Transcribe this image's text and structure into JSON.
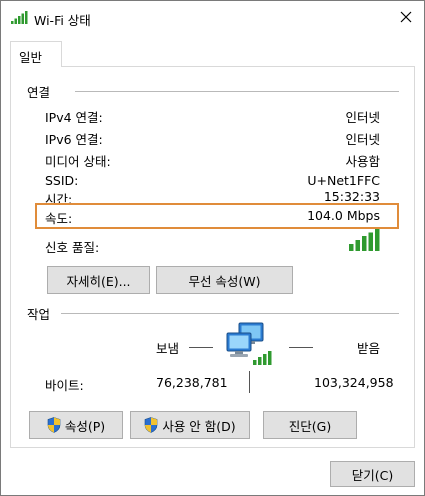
{
  "window": {
    "title": "Wi-Fi 상태",
    "close_symbol": "✕"
  },
  "tabs": [
    {
      "label": "일반"
    }
  ],
  "connection": {
    "header": "연결",
    "rows": [
      {
        "label": "IPv4 연결:",
        "value": "인터넷"
      },
      {
        "label": "IPv6 연결:",
        "value": "인터넷"
      },
      {
        "label": "미디어 상태:",
        "value": "사용함"
      },
      {
        "label": "SSID:",
        "value": "U+Net1FFC"
      },
      {
        "label": "시간:",
        "value": "15:32:33"
      },
      {
        "label": "속도:",
        "value": "104.0 Mbps"
      }
    ],
    "signal_label": "신호 품질:",
    "signal_bars": 5,
    "details_button": "자세히(E)...",
    "wireless_props_button": "무선 속성(W)"
  },
  "activity": {
    "header": "작업",
    "sent_label": "보냄",
    "received_label": "받음",
    "bytes_label": "바이트:",
    "bytes_sent": "76,238,781",
    "bytes_received": "103,324,958"
  },
  "actions": {
    "properties_button": "속성(P)",
    "disable_button": "사용 안 함(D)",
    "diagnose_button": "진단(G)"
  },
  "footer": {
    "close_button": "닫기(C)"
  },
  "colors": {
    "highlight_border": "#e08c3a",
    "signal_green": "#2f9a2f",
    "button_bg": "#e1e1e1"
  }
}
